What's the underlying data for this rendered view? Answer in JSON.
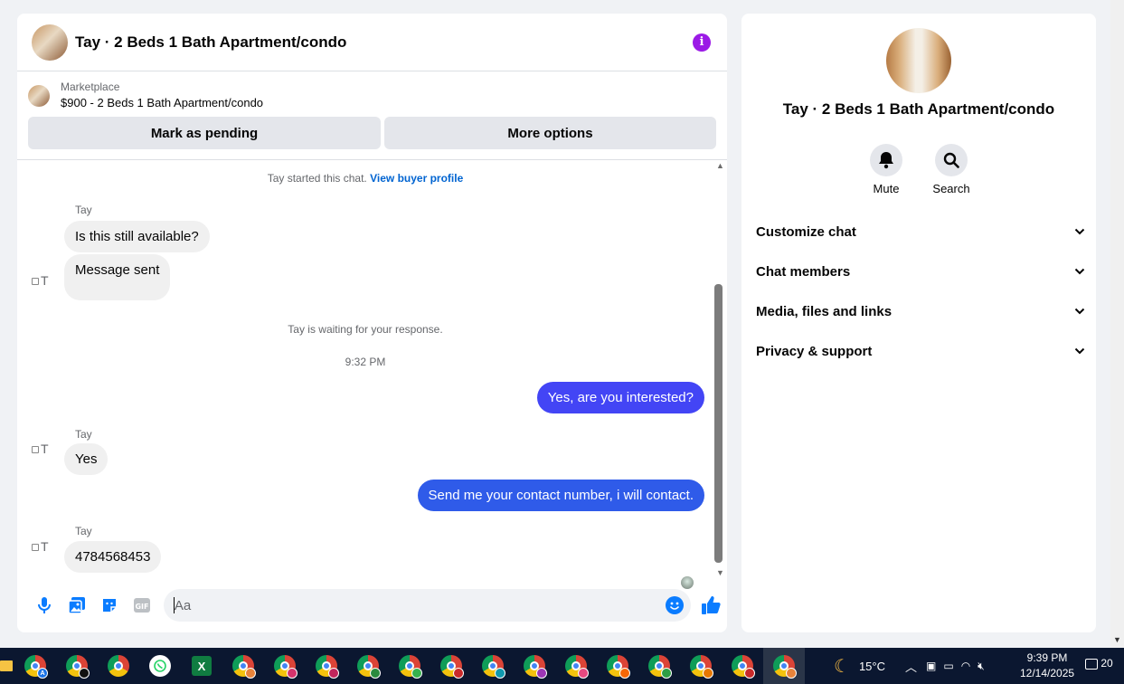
{
  "chat": {
    "title": "Tay · 2 Beds 1 Bath Apartment/condo",
    "info_glyph": "i",
    "marketplace_label": "Marketplace",
    "listing": "$900 - 2 Beds 1 Bath Apartment/condo",
    "mark_pending": "Mark as pending",
    "more_options": "More options",
    "started_note": "Tay started this chat.",
    "view_profile": "View buyer profile",
    "sender_name": "Tay",
    "msg1": "Is this still available?",
    "msg2": "Message sent",
    "waiting_note": "Tay is waiting for your response.",
    "time": "9:32 PM",
    "out1": "Yes, are you interested?",
    "in3": "Yes",
    "out2": "Send me your contact number, i will contact.",
    "in4": "4784568453",
    "avatar_alt": "T",
    "input_placeholder": "Aa"
  },
  "side": {
    "title": "Tay · 2 Beds 1 Bath Apartment/condo",
    "mute": "Mute",
    "search": "Search",
    "sections": [
      "Customize chat",
      "Chat members",
      "Media, files and links",
      "Privacy & support"
    ]
  },
  "taskbar": {
    "weather": "15°C",
    "time": "9:39 PM",
    "date": "12/14/2025",
    "notifications": "20",
    "apps": [
      "file-explorer",
      "chrome-a",
      "chrome-profile",
      "chrome",
      "whatsapp",
      "excel",
      "chrome-profile",
      "chrome-profile",
      "chrome-profile",
      "chrome-profile",
      "chrome-profile",
      "chrome-profile",
      "chrome-profile",
      "chrome-profile",
      "chrome-profile",
      "chrome-profile",
      "chrome-profile",
      "chrome-profile",
      "chrome-profile",
      "chrome-profile"
    ]
  },
  "colors": {
    "accent_purple": "#9b1ae6",
    "outgoing_bubble_1": "#4345f5",
    "outgoing_bubble_2": "#2f5be9",
    "link_blue": "#0064d1",
    "composer_blue": "#0a7cff"
  }
}
